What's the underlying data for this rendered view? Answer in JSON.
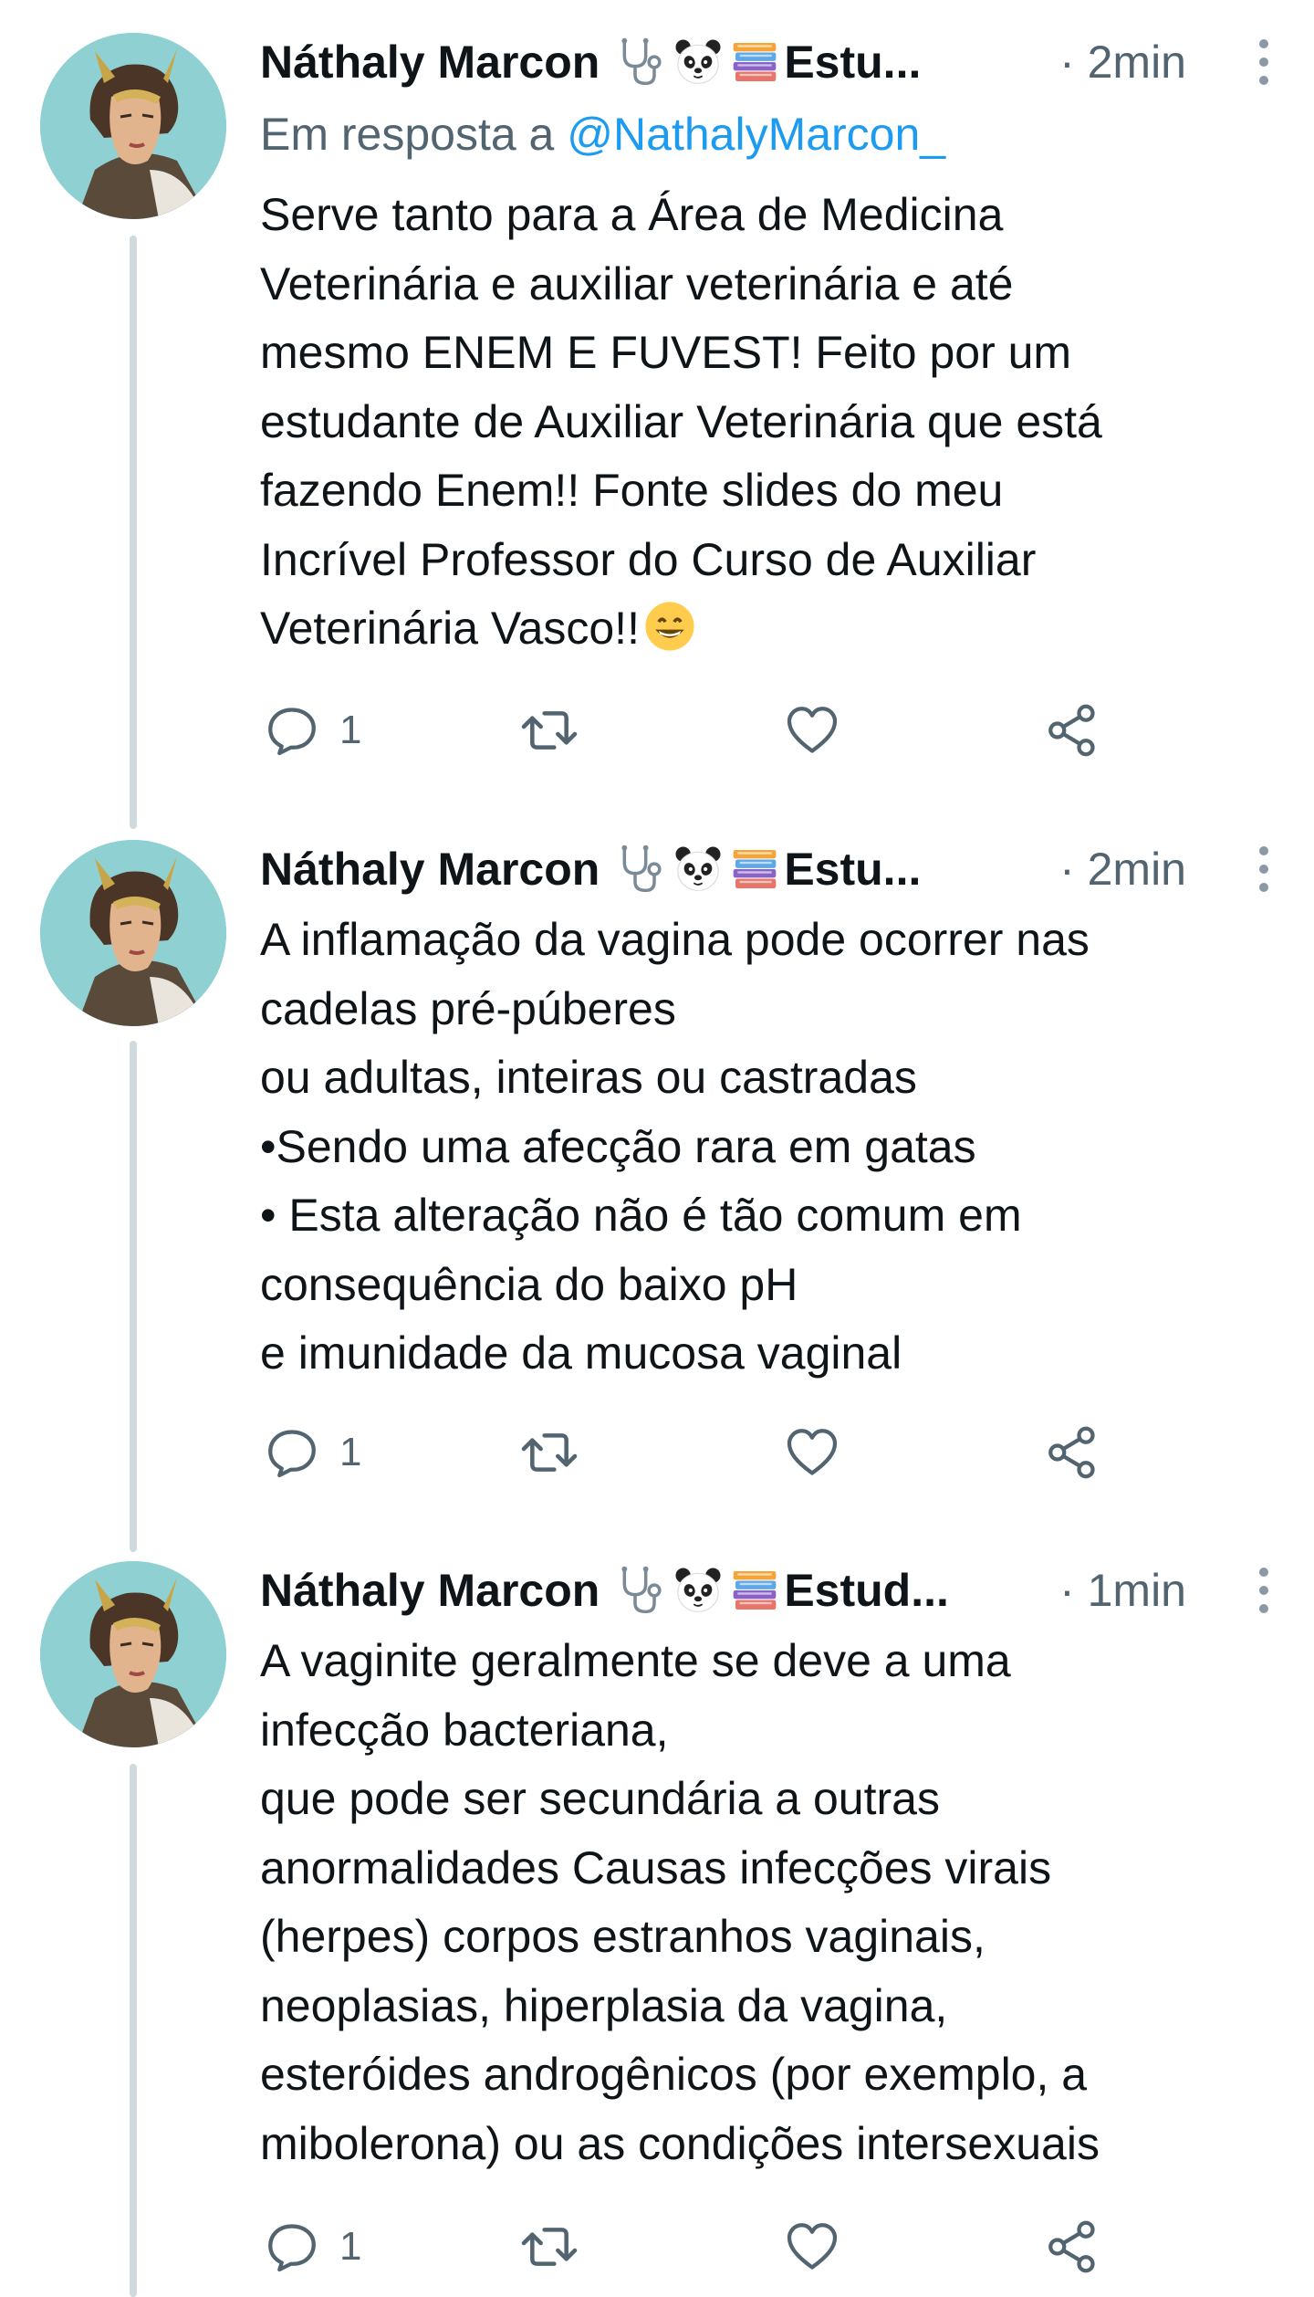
{
  "tweets": [
    {
      "author_name": "Náthaly Marcon",
      "header_emojis": [
        "stethoscope-icon",
        "panda-face-icon",
        "books-icon"
      ],
      "handle_truncated": "Estu...",
      "time": "· 2min",
      "reply_prefix": "Em resposta a",
      "reply_mention": "@NathalyMarcon_",
      "body_lines": [
        "Serve tanto para a Área de Medicina",
        "Veterinária e auxiliar veterinária e até",
        "mesmo ENEM E FUVEST! Feito por um",
        "estudante de Auxiliar Veterinária que está",
        "fazendo Enem!!  Fonte slides do meu",
        "Incrível Professor do Curso de Auxiliar",
        "Veterinária Vasco!!"
      ],
      "trailing_emoji": "grinning-face-icon",
      "reply_count": "1"
    },
    {
      "author_name": "Náthaly Marcon",
      "header_emojis": [
        "stethoscope-icon",
        "panda-face-icon",
        "books-icon"
      ],
      "handle_truncated": "Estu...",
      "time": "· 2min",
      "body_lines": [
        "A inflamação da vagina pode ocorrer nas",
        "cadelas pré-púberes",
        "ou adultas, inteiras ou castradas",
        "•Sendo uma afecção rara em gatas",
        "• Esta alteração não é tão comum em",
        "consequência do baixo pH",
        "e imunidade da mucosa vaginal"
      ],
      "reply_count": "1"
    },
    {
      "author_name": "Náthaly Marcon",
      "header_emojis": [
        "stethoscope-icon",
        "panda-face-icon",
        "books-icon"
      ],
      "handle_truncated": "Estud...",
      "time": "· 1min",
      "body_lines": [
        "A vaginite geralmente se deve a uma",
        "infecção bacteriana,",
        "que pode ser secundária a outras",
        "anormalidades Causas infecções virais",
        "(herpes) corpos estranhos vaginais,",
        "neoplasias, hiperplasia da vagina,",
        "esteróides androgênicos (por exemplo, a",
        "mibolerona) ou as condições intersexuais"
      ],
      "reply_count": "1"
    }
  ],
  "colors": {
    "text": "#0f1419",
    "secondary": "#536471",
    "accent": "#1d9bf0",
    "thread_line": "#cfd9de",
    "avatar_bg": "#8fd0d2"
  }
}
